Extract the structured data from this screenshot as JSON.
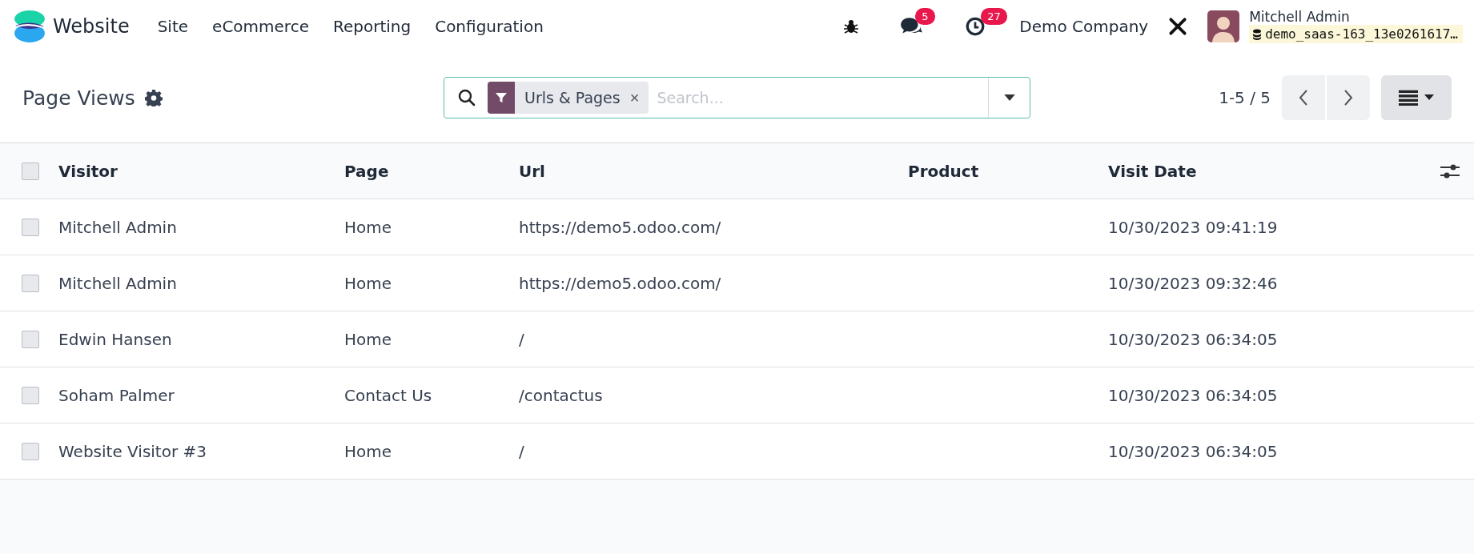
{
  "navbar": {
    "app_name": "Website",
    "menus": [
      "Site",
      "eCommerce",
      "Reporting",
      "Configuration"
    ],
    "messages_count": "5",
    "activities_count": "27",
    "company": "Demo Company",
    "user": {
      "name": "Mitchell Admin",
      "database": "demo_saas-163_13e0261617…"
    }
  },
  "control_panel": {
    "title": "Page Views",
    "search": {
      "facets": [
        {
          "label": "Urls & Pages",
          "remove": "×"
        }
      ],
      "placeholder": "Search..."
    },
    "pager": "1-5 / 5"
  },
  "table": {
    "select_all_checked": false,
    "columns": [
      "Visitor",
      "Page",
      "Url",
      "Product",
      "Visit Date"
    ],
    "rows": [
      {
        "checked": false,
        "cells": [
          "Mitchell Admin",
          "Home",
          "https://demo5.odoo.com/",
          "",
          "10/30/2023 09:41:19"
        ]
      },
      {
        "checked": false,
        "cells": [
          "Mitchell Admin",
          "Home",
          "https://demo5.odoo.com/",
          "",
          "10/30/2023 09:32:46"
        ]
      },
      {
        "checked": false,
        "cells": [
          "Edwin Hansen",
          "Home",
          "/",
          "",
          "10/30/2023 06:34:05"
        ]
      },
      {
        "checked": false,
        "cells": [
          "Soham Palmer",
          "Contact Us",
          "/contactus",
          "",
          "10/30/2023 06:34:05"
        ]
      },
      {
        "checked": false,
        "cells": [
          "Website Visitor #3",
          "Home",
          "/",
          "",
          "10/30/2023 06:34:05"
        ]
      }
    ]
  }
}
